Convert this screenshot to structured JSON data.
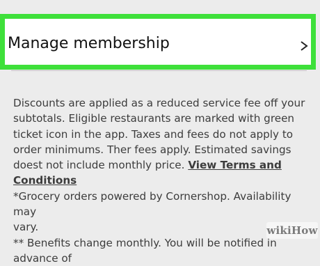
{
  "menu": {
    "manage_membership_label": "Manage membership"
  },
  "disclaimer": {
    "paragraph1_prefix": "Discounts are applied as a reduced service fee off your\nsubtotals. Eligible restaurants are marked with green\nticket icon in the app. Taxes and fees do not apply to\norder minimums. Ther fees apply. Estimated savings\ndoest not include monthly price. ",
    "terms_link_line1": "View Terms and",
    "terms_link_line2": "Conditions",
    "paragraph2": "*Grocery orders powered by Cornershop. Availability may\nvary.",
    "paragraph3": "** Benefits change monthly. You will be notified in",
    "paragraph3_tail": "advance of"
  },
  "watermark": {
    "text": "wikiHow"
  },
  "colors": {
    "highlight_border": "#3ee03a",
    "background": "#ececec",
    "text": "#3c3c3c"
  }
}
